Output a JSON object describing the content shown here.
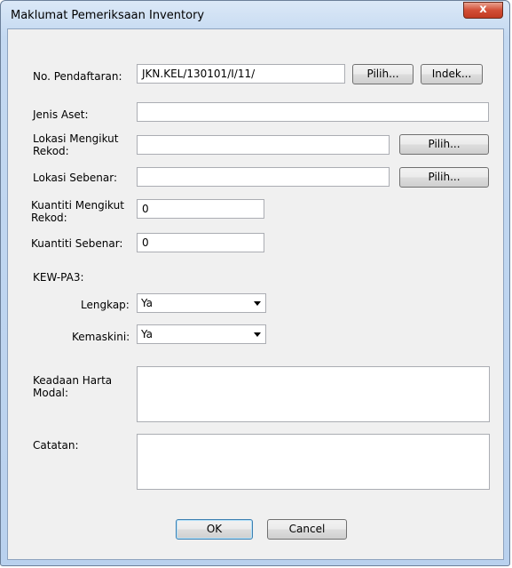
{
  "window": {
    "title": "Maklumat Pemeriksaan Inventory",
    "close_label": "x"
  },
  "form": {
    "no_pendaftaran": {
      "label": "No. Pendaftaran:",
      "value": "JKN.KEL/130101/I/11/"
    },
    "pilih_label": "Pilih...",
    "indek_label": "Indek...",
    "jenis_aset": {
      "label": "Jenis Aset:",
      "value": ""
    },
    "lokasi_mengikut_rekod": {
      "label_line1": "Lokasi Mengikut",
      "label_line2": "Rekod:",
      "value": ""
    },
    "lokasi_sebenar": {
      "label": "Lokasi Sebenar:",
      "value": ""
    },
    "kuantiti_mengikut_rekod": {
      "label_line1": "Kuantiti Mengikut",
      "label_line2": "Rekod:",
      "value": "0"
    },
    "kuantiti_sebenar": {
      "label": "Kuantiti Sebenar:",
      "value": "0"
    },
    "kewpa3": {
      "label": "KEW-PA3:"
    },
    "lengkap": {
      "label": "Lengkap:",
      "value": "Ya"
    },
    "kemaskini": {
      "label": "Kemaskini:",
      "value": "Ya"
    },
    "keadaan_harta_modal": {
      "label_line1": "Keadaan Harta",
      "label_line2": "Modal:",
      "value": ""
    },
    "catatan": {
      "label": "Catatan:",
      "value": ""
    }
  },
  "buttons": {
    "ok": "OK",
    "cancel": "Cancel"
  }
}
